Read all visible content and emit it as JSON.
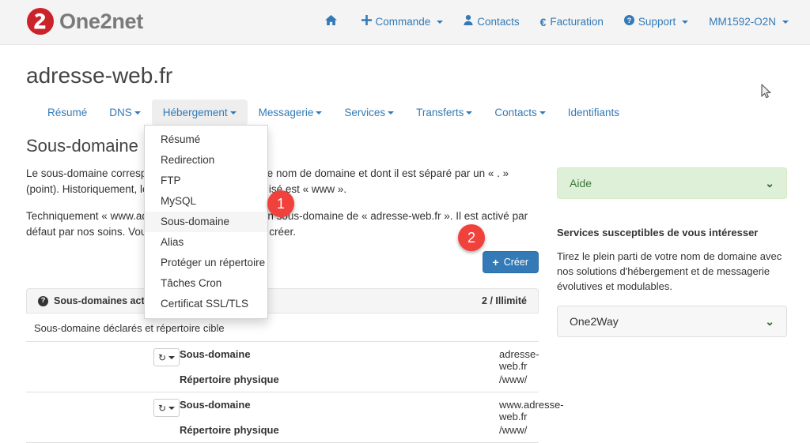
{
  "header": {
    "brand": "One2net",
    "brand_logo_color": "#cc2229",
    "nav": [
      {
        "label": "",
        "icon": "home-icon",
        "name": "home",
        "caret": false
      },
      {
        "label": "Commande",
        "icon": "plus-icon",
        "name": "commande",
        "caret": true
      },
      {
        "label": "Contacts",
        "icon": "user-icon",
        "name": "contacts",
        "caret": false
      },
      {
        "label": "Facturation",
        "icon": "euro-icon",
        "name": "facturation",
        "caret": false
      },
      {
        "label": "Support",
        "icon": "question-circle-icon",
        "name": "support",
        "caret": true
      },
      {
        "label": "MM1592-O2N",
        "icon": "",
        "name": "account",
        "caret": true
      }
    ]
  },
  "page": {
    "title": "adresse-web.fr",
    "accent_color": "#337ab7"
  },
  "tabs": [
    {
      "label": "Résumé",
      "caret": false,
      "active": false
    },
    {
      "label": "DNS",
      "caret": true,
      "active": false
    },
    {
      "label": "Hébergement",
      "caret": true,
      "active": true
    },
    {
      "label": "Messagerie",
      "caret": true,
      "active": false
    },
    {
      "label": "Services",
      "caret": true,
      "active": false
    },
    {
      "label": "Transferts",
      "caret": true,
      "active": false
    },
    {
      "label": "Contacts",
      "caret": true,
      "active": false
    },
    {
      "label": "Identifiants",
      "caret": false,
      "active": false
    }
  ],
  "dropdown": {
    "open": true,
    "items": [
      {
        "label": "Résumé",
        "highlight": false
      },
      {
        "label": "Redirection",
        "highlight": false
      },
      {
        "label": "FTP",
        "highlight": false
      },
      {
        "label": "MySQL",
        "highlight": false
      },
      {
        "label": "Sous-domaine",
        "highlight": true
      },
      {
        "label": "Alias",
        "highlight": false
      },
      {
        "label": "Protéger un répertoire",
        "highlight": false
      },
      {
        "label": "Tâches Cron",
        "highlight": false
      },
      {
        "label": "Certificat SSL/TLS",
        "highlight": false
      }
    ]
  },
  "main": {
    "section_title": "Sous-domaine",
    "paragraph1": "Le sous-domaine correspond à ce qui précède votre nom de domaine et dont il est séparé par un « . » (point). Historiquement, le sous-domaine le plus utilisé est « www ».",
    "paragraph2": "Techniquement « www.adresse-web.fr » est donc un sous-domaine de « adresse-web.fr ». Il est activé par défaut par nos soins. Vous n'avez pas besoin de le créer.",
    "create_button": "Créer",
    "panel": {
      "title": "Sous-domaines actifs",
      "count": "2 / Illimité",
      "subtitle": "Sous-domaine déclarés et répertoire cible",
      "rows": [
        {
          "label_domain": "Sous-domaine",
          "value_domain": "adresse-web.fr",
          "label_dir": "Répertoire physique",
          "value_dir": "/www/"
        },
        {
          "label_domain": "Sous-domaine",
          "value_domain": "www.adresse-web.fr",
          "label_dir": "Répertoire physique",
          "value_dir": "/www/"
        }
      ]
    }
  },
  "sidebar": {
    "aide_label": "Aide",
    "aide_bg_color": "#dff0d8",
    "services_title": "Services susceptibles de vous intéresser",
    "services_text": "Tirez le plein parti de votre nom de domaine avec nos solutions d'hébergement et de messagerie évolutives et modulables.",
    "service_select_value": "One2Way"
  },
  "annotations": {
    "badge1": "1",
    "badge2": "2",
    "badge_color": "#f0413c"
  }
}
